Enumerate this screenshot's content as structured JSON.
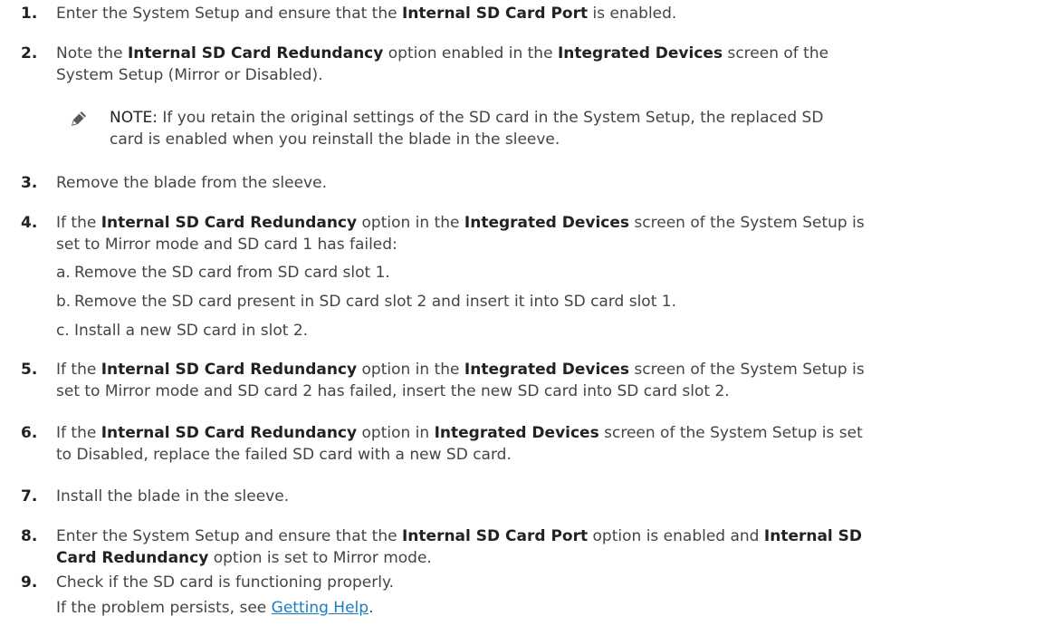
{
  "steps": [
    {
      "num": "1.",
      "t1": "Enter the System Setup and ensure that the ",
      "b1": "Internal SD Card Port",
      "t2": " is enabled."
    },
    {
      "num": "2.",
      "t1": "Note the ",
      "b1": "Internal SD Card Redundancy",
      "t2": " option enabled in the ",
      "b2": "Integrated Devices",
      "t3": " screen of the",
      "l2": "System Setup (Mirror or Disabled)."
    },
    {
      "num": "3.",
      "t1": "Remove the blade from the sleeve."
    },
    {
      "num": "4.",
      "t1": "If the ",
      "b1": "Internal SD Card Redundancy",
      "t2": " option in the ",
      "b2": "Integrated Devices",
      "t3": " screen of the System Setup is",
      "l2": "set to Mirror mode and SD card 1 has failed:"
    },
    {
      "num": "5.",
      "t1": "If the ",
      "b1": "Internal SD Card Redundancy",
      "t2": " option in the ",
      "b2": "Integrated Devices",
      "t3": " screen of the System Setup is",
      "l2": "set to Mirror mode and SD card 2 has failed, insert the new SD card into SD card slot 2."
    },
    {
      "num": "6.",
      "t1": "If the ",
      "b1": "Internal SD Card Redundancy",
      "t2": " option in ",
      "b2": "Integrated Devices",
      "t3": " screen of the System Setup is set",
      "l2": "to Disabled, replace the failed SD card with a new SD card."
    },
    {
      "num": "7.",
      "t1": "Install the blade in the sleeve."
    },
    {
      "num": "8.",
      "t1": "Enter the System Setup and ensure that the ",
      "b1": "Internal SD Card Port",
      "t2": " option is enabled and ",
      "b2": "Internal SD",
      "b3": "Card Redundancy",
      "t3": " option is set to Mirror mode."
    },
    {
      "num": "9.",
      "t1": "Check if the SD card is functioning properly.",
      "l2a": "If the problem persists, see ",
      "link": "Getting Help",
      "l2b": "."
    }
  ],
  "note": {
    "label": "NOTE:",
    "line1": " If you retain the original settings of the SD card in the System Setup, the replaced SD",
    "line2": "card is enabled when you reinstall the blade in the sleeve."
  },
  "substeps": [
    {
      "letter": "a.",
      "text": "Remove the SD card from SD card slot 1."
    },
    {
      "letter": "b.",
      "text": "Remove the SD card present in SD card slot 2 and insert it into SD card slot 1."
    },
    {
      "letter": "c.",
      "text": "Install a new SD card in slot 2."
    }
  ],
  "colors": {
    "text": "#444444",
    "bold": "#222222",
    "link": "#1a7fc0"
  },
  "icons": {
    "note": "pencil-note-icon"
  }
}
